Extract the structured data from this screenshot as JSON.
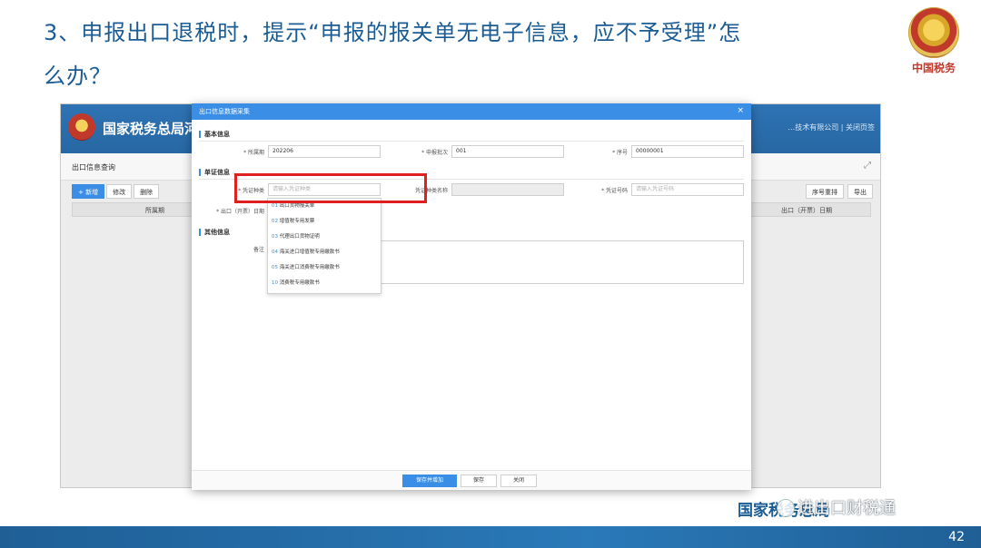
{
  "slide": {
    "title_line1": "3、申报出口退税时，提示“申报的报关单无电子信息，应不予受理”怎",
    "title_line2": "么办？",
    "brand": "中国税务",
    "page_number": "42",
    "footer_org": "国家税务总局",
    "watermark": "进出口财税通"
  },
  "app": {
    "header_title": "国家税务总局河",
    "header_right": "…技术有限公司  |  关闭页签",
    "subbar_title": "出口信息查询",
    "toolbar": [
      "+ 新增",
      "修改",
      "删除"
    ],
    "toolbar_right": [
      "序号重排",
      "导出"
    ],
    "grid_headers": [
      "所属期",
      "出口（开票）日期"
    ]
  },
  "modal": {
    "title": "出口信息数据采集",
    "close": "×",
    "sections": {
      "basic": "基本信息",
      "voucher": "单证信息",
      "other": "其他信息"
    },
    "fields": {
      "period_label": "* 所属期",
      "period_value": "202206",
      "batch_label": "* 申报批次",
      "batch_value": "001",
      "seq_label": "* 序号",
      "seq_value": "00000001",
      "voucher_type_label": "* 凭证种类",
      "voucher_type_placeholder": "请输入凭证种类",
      "voucher_name_label": "凭证种类名称",
      "voucher_no_label": "* 凭证号码",
      "voucher_no_placeholder": "请输入凭证号码",
      "export_date_label": "* 出口（开票）日期",
      "remark_label": "备注"
    },
    "dropdown": [
      {
        "code": "01",
        "text": "出口货物报关单"
      },
      {
        "code": "02",
        "text": "增值税专用发票"
      },
      {
        "code": "03",
        "text": "代理出口货物证明"
      },
      {
        "code": "04",
        "text": "海关进口增值税专用缴款书"
      },
      {
        "code": "05",
        "text": "海关进口消费税专用缴款书"
      },
      {
        "code": "10",
        "text": "消费税专用缴款书"
      }
    ],
    "footer_buttons": {
      "save_add": "保存并增加",
      "save": "保存",
      "close": "关闭"
    }
  },
  "colors": {
    "title": "#1a5c93",
    "accent": "#3a8ee6",
    "highlight": "#e02020"
  }
}
